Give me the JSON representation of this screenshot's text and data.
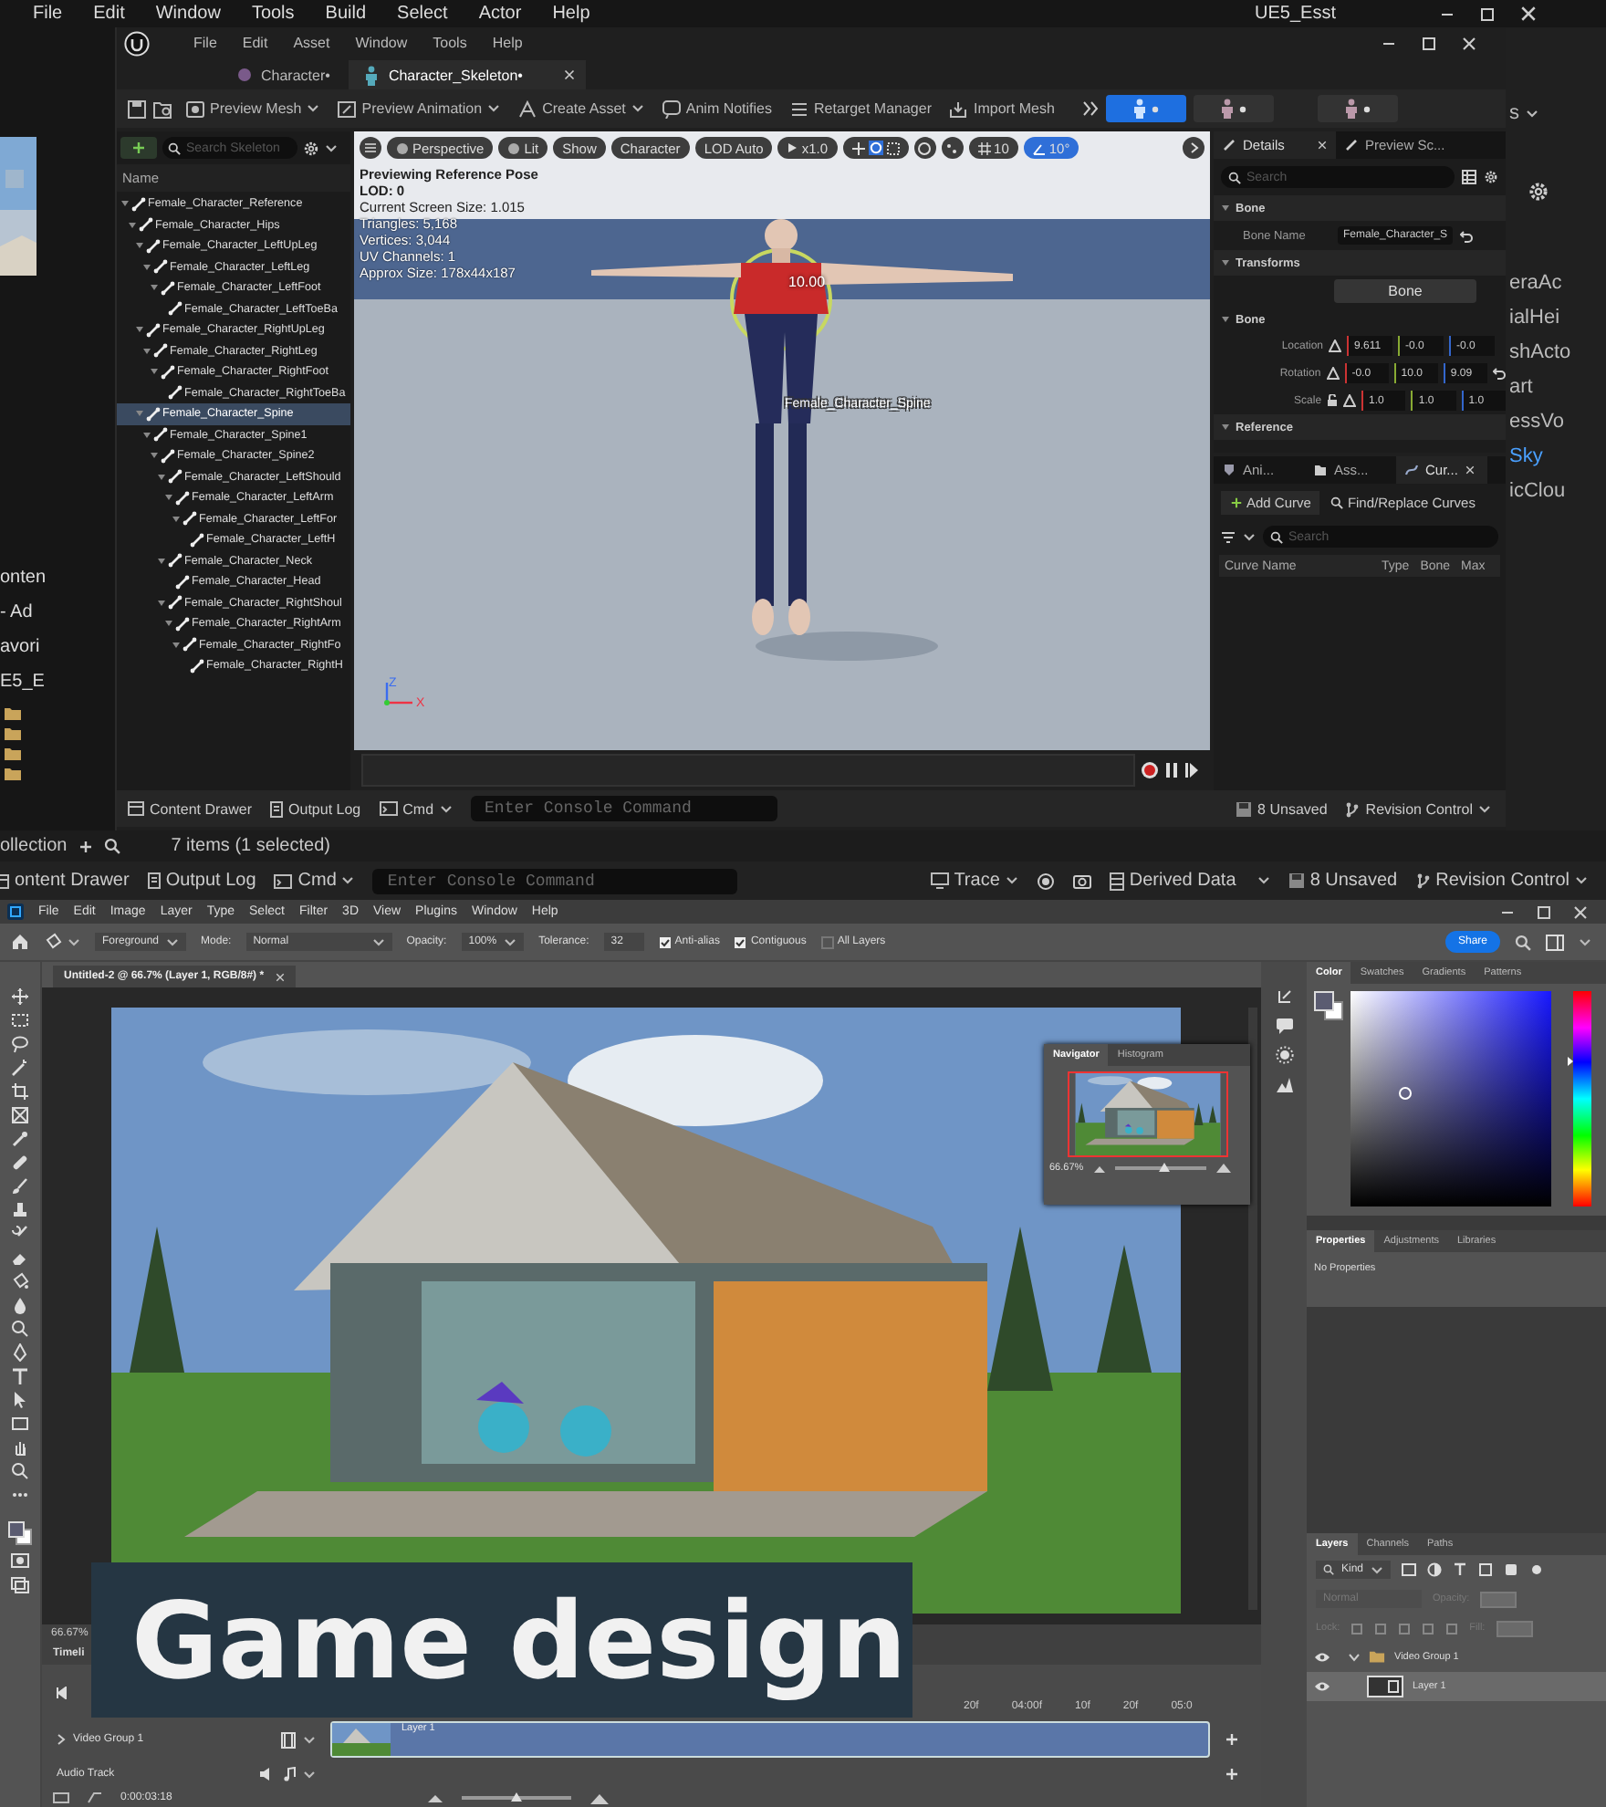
{
  "ue": {
    "menu": [
      "File",
      "Edit",
      "Window",
      "Tools",
      "Build",
      "Select",
      "Actor",
      "Help"
    ],
    "project_title": "UE5_Esst",
    "left_fragments": [
      "onten",
      "- Ad",
      "avori",
      "E5_E"
    ],
    "right_top": "s",
    "right_fragments": [
      {
        "text": "eraAc",
        "selected": false
      },
      {
        "text": "ialHei",
        "selected": false
      },
      {
        "text": "shActo",
        "selected": false
      },
      {
        "text": "art",
        "selected": false
      },
      {
        "text": "essVo",
        "selected": false
      },
      {
        "text": "Sky",
        "selected": true
      },
      {
        "text": "icClou",
        "selected": false
      }
    ],
    "inner_menu": [
      "File",
      "Edit",
      "Asset",
      "Window",
      "Tools",
      "Help"
    ],
    "tabs": [
      {
        "label": "Character•",
        "selected": false
      },
      {
        "label": "Character_Skeleton•",
        "selected": true
      }
    ],
    "toolbar": [
      {
        "label": "Preview Mesh",
        "dropdown": true
      },
      {
        "label": "Preview Animation",
        "dropdown": true
      },
      {
        "label": "Create Asset",
        "dropdown": true
      },
      {
        "label": "Anim Notifies",
        "dropdown": false
      },
      {
        "label": "Retarget Manager",
        "dropdown": false
      },
      {
        "label": "Import Mesh",
        "dropdown": false
      }
    ],
    "modes": [
      {
        "selected": true
      },
      {
        "selected": false
      },
      {
        "selected": false
      }
    ],
    "skeleton": {
      "search_placeholder": "Search Skeleton",
      "header": "Name",
      "tree": [
        {
          "label": "Female_Character_Reference",
          "selected": false,
          "children": [
            {
              "label": "Female_Character_Hips",
              "selected": false,
              "children": [
                {
                  "label": "Female_Character_LeftUpLeg",
                  "selected": false,
                  "children": [
                    {
                      "label": "Female_Character_LeftLeg",
                      "selected": false,
                      "children": [
                        {
                          "label": "Female_Character_LeftFoot",
                          "selected": false,
                          "children": [
                            {
                              "label": "Female_Character_LeftToeBa",
                              "selected": false
                            }
                          ]
                        }
                      ]
                    }
                  ]
                },
                {
                  "label": "Female_Character_RightUpLeg",
                  "selected": false,
                  "children": [
                    {
                      "label": "Female_Character_RightLeg",
                      "selected": false,
                      "children": [
                        {
                          "label": "Female_Character_RightFoot",
                          "selected": false,
                          "children": [
                            {
                              "label": "Female_Character_RightToeBa",
                              "selected": false
                            }
                          ]
                        }
                      ]
                    }
                  ]
                },
                {
                  "label": "Female_Character_Spine",
                  "selected": true,
                  "children": [
                    {
                      "label": "Female_Character_Spine1",
                      "selected": false,
                      "children": [
                        {
                          "label": "Female_Character_Spine2",
                          "selected": false,
                          "children": [
                            {
                              "label": "Female_Character_LeftShould",
                              "selected": false,
                              "children": [
                                {
                                  "label": "Female_Character_LeftArm",
                                  "selected": false,
                                  "children": [
                                    {
                                      "label": "Female_Character_LeftFor",
                                      "selected": false,
                                      "children": [
                                        {
                                          "label": "Female_Character_LeftH",
                                          "selected": false
                                        }
                                      ]
                                    }
                                  ]
                                }
                              ]
                            },
                            {
                              "label": "Female_Character_Neck",
                              "selected": false,
                              "children": [
                                {
                                  "label": "Female_Character_Head",
                                  "selected": false
                                }
                              ]
                            },
                            {
                              "label": "Female_Character_RightShoul",
                              "selected": false,
                              "children": [
                                {
                                  "label": "Female_Character_RightArm",
                                  "selected": false,
                                  "children": [
                                    {
                                      "label": "Female_Character_RightFo",
                                      "selected": false,
                                      "children": [
                                        {
                                          "label": "Female_Character_RightH",
                                          "selected": false
                                        }
                                      ]
                                    }
                                  ]
                                }
                              ]
                            }
                          ]
                        }
                      ]
                    }
                  ]
                }
              ]
            }
          ]
        }
      ]
    },
    "viewport": {
      "buttons": [
        "Perspective",
        "Lit",
        "Show",
        "Character",
        "LOD Auto"
      ],
      "speed": "x1.0",
      "grid": "10",
      "angle": "10°",
      "info": [
        "Previewing Reference Pose",
        "LOD: 0",
        "Current Screen Size: 1.015",
        "Triangles: 5,168",
        "Vertices: 3,044",
        "UV Channels: 1",
        "Approx Size: 178x44x187"
      ],
      "timer": "10.00",
      "bone_label": "Female_Character_Spine",
      "axes": [
        "Z",
        "X"
      ]
    },
    "details": {
      "tabs": [
        {
          "label": "Details",
          "selected": true
        },
        {
          "label": "Preview Sc...",
          "selected": false
        }
      ],
      "search_placeholder": "Search",
      "bone_section": "Bone",
      "bone_name_label": "Bone Name",
      "bone_name": "Female_Character_S",
      "transforms_section": "Transforms",
      "space_button": "Bone",
      "bone_group": "Bone",
      "transforms": [
        {
          "label": "Location",
          "values": [
            "9.611",
            "-0.0",
            "-0.0"
          ]
        },
        {
          "label": "Rotation",
          "values": [
            "-0.0",
            "10.0",
            "9.09"
          ]
        },
        {
          "label": "Scale",
          "values": [
            "1.0",
            "1.0",
            "1.0"
          ]
        }
      ],
      "reference_section": "Reference"
    },
    "curves": {
      "tabs": [
        {
          "label": "Ani...",
          "selected": false
        },
        {
          "label": "Ass...",
          "selected": false
        },
        {
          "label": "Cur...",
          "selected": true
        }
      ],
      "add": "Add Curve",
      "find": "Find/Replace Curves",
      "search_placeholder": "Search",
      "columns": [
        "Curve Name",
        "Type",
        "Bone",
        "Max"
      ]
    },
    "status": {
      "content_drawer": "Content Drawer",
      "output_log": "Output Log",
      "cmd": "Cmd",
      "console_placeholder": "Enter Console Command",
      "unsaved": "8 Unsaved",
      "revision": "Revision Control"
    },
    "outer_footer": {
      "collection": "ollection",
      "count": "7 items (1 selected)"
    },
    "outer_status": {
      "content_drawer": "ontent Drawer",
      "output_log": "Output Log",
      "cmd": "Cmd",
      "console_placeholder": "Enter Console Command",
      "trace": "Trace",
      "derived": "Derived Data",
      "unsaved": "8 Unsaved",
      "revision": "Revision Control"
    }
  },
  "ps": {
    "menu": [
      "File",
      "Edit",
      "Image",
      "Layer",
      "Type",
      "Select",
      "Filter",
      "3D",
      "View",
      "Plugins",
      "Window",
      "Help"
    ],
    "options": {
      "fill_source": "Foreground",
      "mode_label": "Mode:",
      "mode": "Normal",
      "opacity_label": "Opacity:",
      "opacity": "100%",
      "tolerance_label": "Tolerance:",
      "tolerance": "32",
      "checks": [
        {
          "label": "Anti-alias",
          "checked": true
        },
        {
          "label": "Contiguous",
          "checked": true
        },
        {
          "label": "All Layers",
          "checked": false
        }
      ],
      "share": "Share"
    },
    "doc_tab": "Untitled-2 @ 66.7% (Layer 1, RGB/8#) *",
    "navigator": {
      "tabs": [
        {
          "label": "Navigator",
          "selected": true
        },
        {
          "label": "Histogram",
          "selected": false
        }
      ],
      "zoom": "66.67%"
    },
    "color_tabs": [
      {
        "label": "Color",
        "selected": true
      },
      {
        "label": "Swatches",
        "selected": false
      },
      {
        "label": "Gradients",
        "selected": false
      },
      {
        "label": "Patterns",
        "selected": false
      }
    ],
    "properties_tabs": [
      {
        "label": "Properties",
        "selected": true
      },
      {
        "label": "Adjustments",
        "selected": false
      },
      {
        "label": "Libraries",
        "selected": false
      }
    ],
    "properties_text": "No Properties",
    "layers_tabs": [
      {
        "label": "Layers",
        "selected": true
      },
      {
        "label": "Channels",
        "selected": false
      },
      {
        "label": "Paths",
        "selected": false
      }
    ],
    "kind": "Kind",
    "blend": "Normal",
    "opacity_label": "Opacity:",
    "lock_label": "Lock:",
    "fill_label": "Fill:",
    "layers": [
      {
        "name": "Video Group 1",
        "kind": "group",
        "visible": true,
        "selected": false,
        "children": [
          {
            "name": "Layer 1",
            "kind": "layer",
            "visible": true,
            "selected": true
          }
        ]
      }
    ],
    "hue_slider": {
      "level": 0.68
    },
    "navigator_zoom": {
      "level": 0.55
    },
    "timeline_zoom": {
      "level": 0.5
    },
    "status_zoom": "66.67%",
    "timeline": {
      "title": "Timeli",
      "ticks": [
        "20f",
        "04:00f",
        "10f",
        "20f",
        "05:0"
      ],
      "tracks": [
        {
          "name": "Video Group 1",
          "kind": "video"
        },
        {
          "name": "Audio Track",
          "kind": "audio"
        }
      ],
      "clip": "Layer 1",
      "time": "0:00:03:18"
    }
  },
  "caption": "Game design"
}
